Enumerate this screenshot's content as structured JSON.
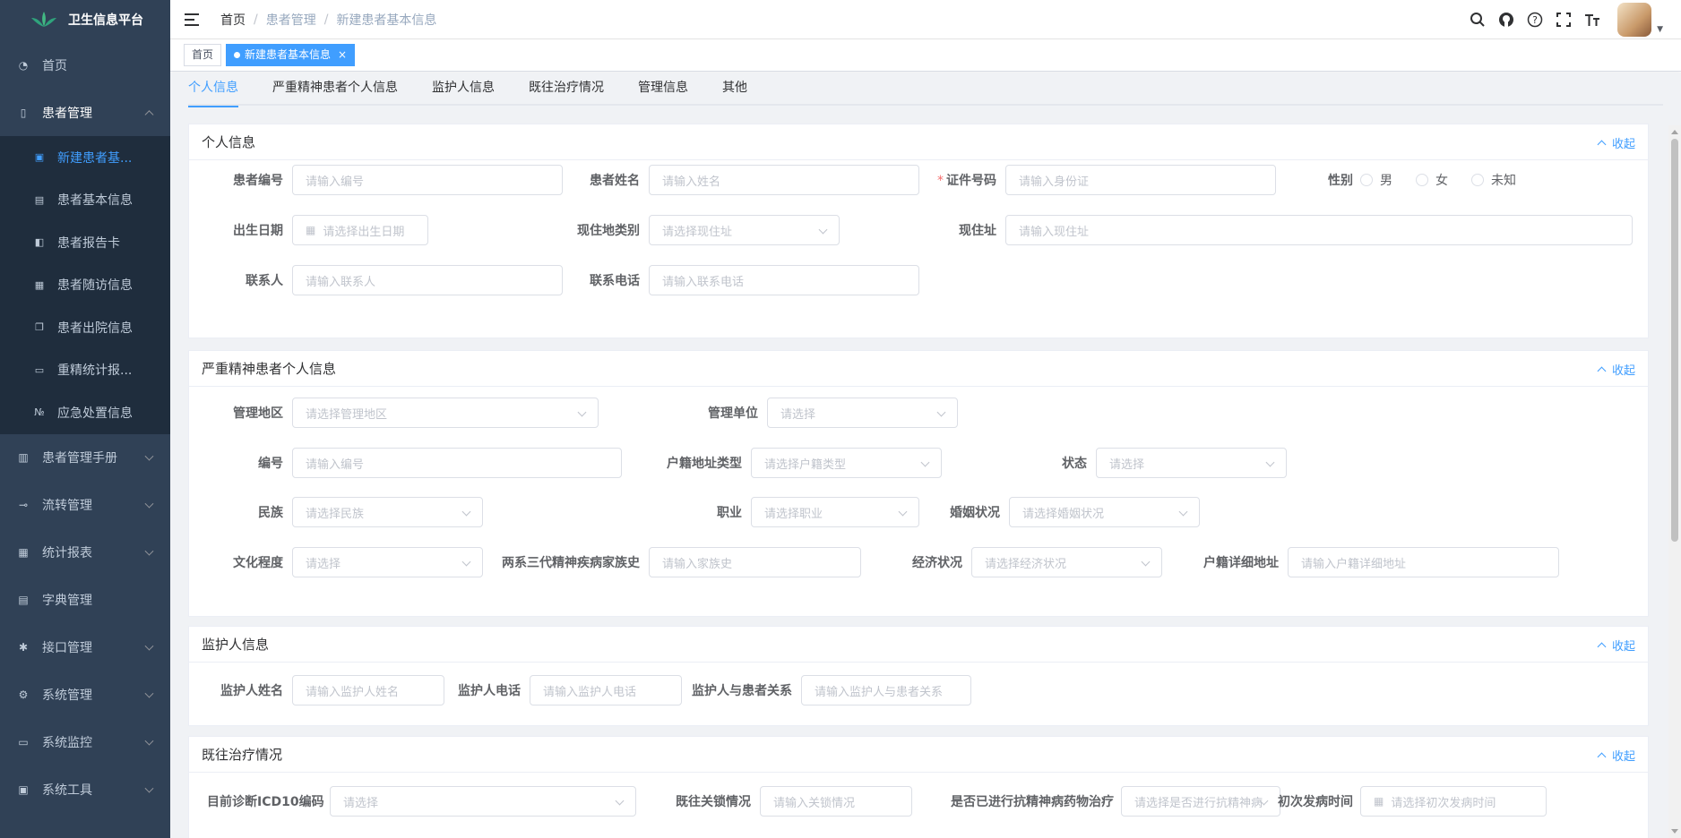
{
  "app": {
    "title": "卫生信息平台"
  },
  "sidebar": {
    "items": [
      {
        "label": "首页",
        "icon": "dashboard-icon"
      },
      {
        "label": "患者管理",
        "icon": "book-icon",
        "expanded": true
      },
      {
        "label": "患者管理手册",
        "icon": "manual-icon"
      },
      {
        "label": "流转管理",
        "icon": "flow-icon"
      },
      {
        "label": "统计报表",
        "icon": "table-icon"
      },
      {
        "label": "字典管理",
        "icon": "document-icon"
      },
      {
        "label": "接口管理",
        "icon": "bug-icon"
      },
      {
        "label": "系统管理",
        "icon": "gear-icon"
      },
      {
        "label": "系统监控",
        "icon": "monitor-icon"
      },
      {
        "label": "系统工具",
        "icon": "toolbox-icon"
      }
    ],
    "subitems": [
      {
        "label": "新建患者基...",
        "active": true
      },
      {
        "label": "患者基本信息"
      },
      {
        "label": "患者报告卡"
      },
      {
        "label": "患者随访信息"
      },
      {
        "label": "患者出院信息"
      },
      {
        "label": "重精统计报..."
      },
      {
        "label": "应急处置信息"
      }
    ]
  },
  "breadcrumb": [
    "首页",
    "患者管理",
    "新建患者基本信息"
  ],
  "tags": [
    {
      "label": "首页"
    },
    {
      "label": "新建患者基本信息",
      "active": true,
      "close": "×"
    }
  ],
  "tabs": [
    "个人信息",
    "严重精神患者个人信息",
    "监护人信息",
    "既往治疗情况",
    "管理信息",
    "其他"
  ],
  "collapse_label": "收起",
  "sections": {
    "personal": {
      "title": "个人信息",
      "fields": {
        "patient_no": {
          "label": "患者编号",
          "placeholder": "请输入编号"
        },
        "patient_name": {
          "label": "患者姓名",
          "placeholder": "请输入姓名"
        },
        "id_no": {
          "label": "证件号码",
          "placeholder": "请输入身份证",
          "required": "*"
        },
        "gender": {
          "label": "性别",
          "options": [
            "男",
            "女",
            "未知"
          ]
        },
        "birth": {
          "label": "出生日期",
          "placeholder": "请选择出生日期"
        },
        "addr_type": {
          "label": "现住地类别",
          "placeholder": "请选择现住址"
        },
        "addr": {
          "label": "现住址",
          "placeholder": "请输入现住址"
        },
        "contact": {
          "label": "联系人",
          "placeholder": "请输入联系人"
        },
        "phone": {
          "label": "联系电话",
          "placeholder": "请输入联系电话"
        }
      }
    },
    "severe": {
      "title": "严重精神患者个人信息",
      "fields": {
        "region": {
          "label": "管理地区",
          "placeholder": "请选择管理地区"
        },
        "unit": {
          "label": "管理单位",
          "placeholder": "请选择"
        },
        "no": {
          "label": "编号",
          "placeholder": "请输入编号"
        },
        "hukou_type": {
          "label": "户籍地址类型",
          "placeholder": "请选择户籍类型"
        },
        "status": {
          "label": "状态",
          "placeholder": "请选择"
        },
        "ethnic": {
          "label": "民族",
          "placeholder": "请选择民族"
        },
        "job": {
          "label": "职业",
          "placeholder": "请选择职业"
        },
        "marriage": {
          "label": "婚姻状况",
          "placeholder": "请选择婚姻状况"
        },
        "education": {
          "label": "文化程度",
          "placeholder": "请选择"
        },
        "family_history": {
          "label": "两系三代精神疾病家族史",
          "placeholder": "请输入家族史"
        },
        "economy": {
          "label": "经济状况",
          "placeholder": "请选择经济状况"
        },
        "hukou_addr": {
          "label": "户籍详细地址",
          "placeholder": "请输入户籍详细地址"
        }
      }
    },
    "guardian": {
      "title": "监护人信息",
      "fields": {
        "name": {
          "label": "监护人姓名",
          "placeholder": "请输入监护人姓名"
        },
        "phone": {
          "label": "监护人电话",
          "placeholder": "请输入监护人电话"
        },
        "relation": {
          "label": "监护人与患者关系",
          "placeholder": "请输入监护人与患者关系"
        }
      }
    },
    "treatment": {
      "title": "既往治疗情况",
      "fields": {
        "icd10": {
          "label": "目前诊断ICD10编码",
          "placeholder": "请选择"
        },
        "lock": {
          "label": "既往关锁情况",
          "placeholder": "请输入关锁情况"
        },
        "drug": {
          "label": "是否已进行抗精神病药物治疗",
          "placeholder": "请选择是否进行抗精神病"
        },
        "onset": {
          "label": "初次发病时间",
          "placeholder": "请选择初次发病时间"
        }
      }
    }
  }
}
